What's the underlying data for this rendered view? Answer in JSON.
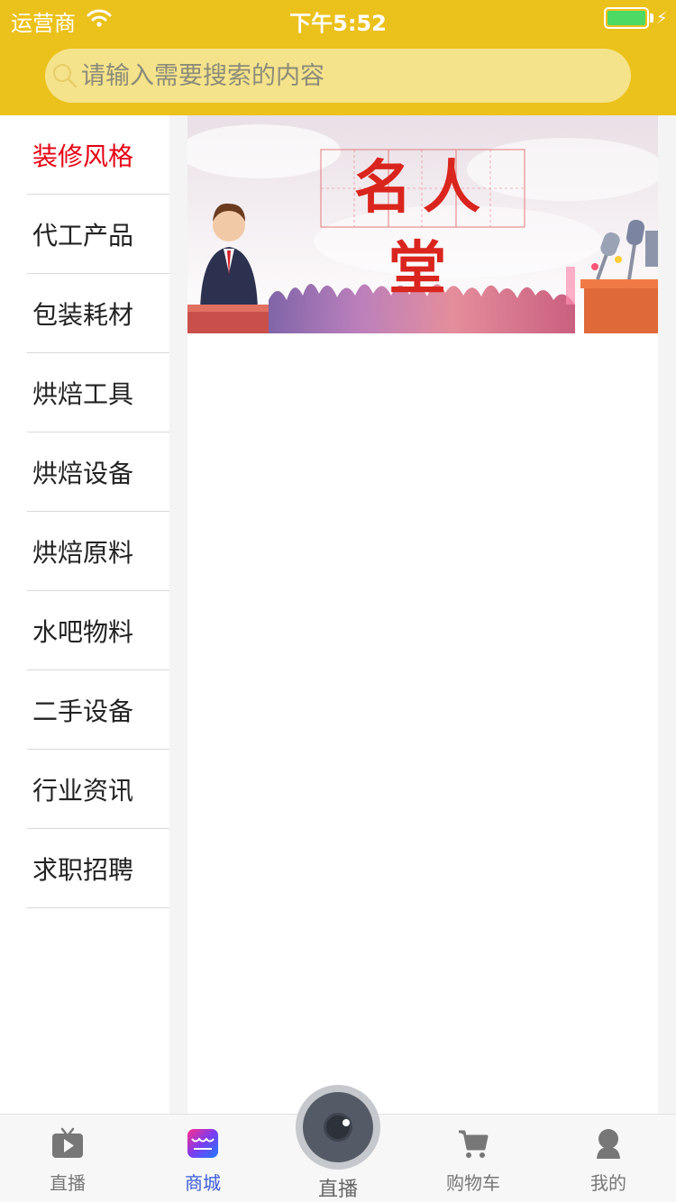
{
  "status_bar": {
    "carrier": "运营商",
    "time": "下午5:52"
  },
  "search": {
    "placeholder": "请输入需要搜索的内容"
  },
  "sidebar": {
    "items": [
      {
        "label": "装修风格",
        "active": true
      },
      {
        "label": "代工产品"
      },
      {
        "label": "包装耗材"
      },
      {
        "label": "烘焙工具"
      },
      {
        "label": "烘焙设备"
      },
      {
        "label": "烘焙原料"
      },
      {
        "label": "水吧物料"
      },
      {
        "label": "二手设备"
      },
      {
        "label": "行业资讯"
      },
      {
        "label": "求职招聘"
      }
    ]
  },
  "banner": {
    "title": "名人堂"
  },
  "tabbar": {
    "tabs": [
      {
        "label": "直播",
        "icon": "tv-play-icon"
      },
      {
        "label": "商城",
        "icon": "shop-icon",
        "active": true
      },
      {
        "label": "直播",
        "icon": "camera-icon"
      },
      {
        "label": "购物车",
        "icon": "cart-icon"
      },
      {
        "label": "我的",
        "icon": "user-icon"
      }
    ]
  },
  "colors": {
    "header": "#ebc11b",
    "active_text": "#e60012",
    "active_tab": "#3b5bdb"
  }
}
